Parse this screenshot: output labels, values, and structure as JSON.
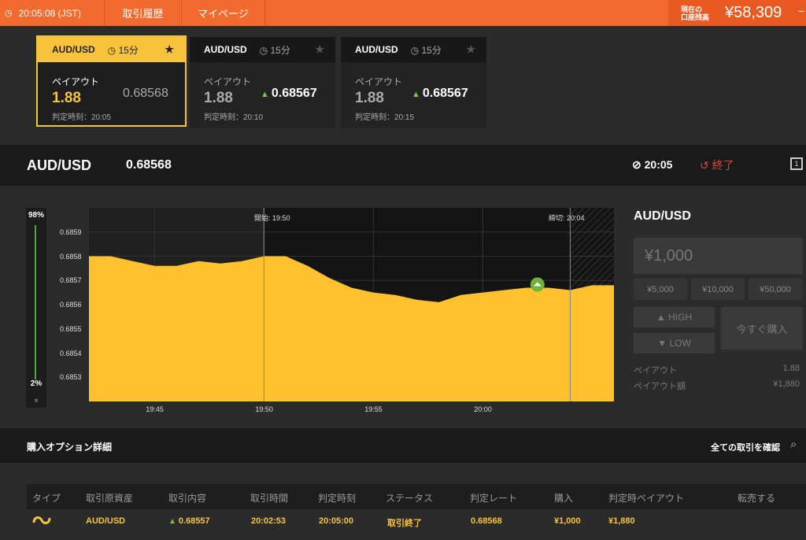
{
  "topbar": {
    "time": "20:05:08 (JST)",
    "nav": [
      "取引履歴",
      "マイページ"
    ],
    "balance_label_1": "現在の",
    "balance_label_2": "口座残高",
    "balance_value": "¥58,309"
  },
  "cards": [
    {
      "asset": "AUD/USD",
      "duration": "15分",
      "payout_label": "ペイアウト",
      "payout": "1.88",
      "rate": "0.68568",
      "judge": "判定時刻：20:05",
      "active": true
    },
    {
      "asset": "AUD/USD",
      "duration": "15分",
      "payout_label": "ペイアウト",
      "payout": "1.88",
      "rate": "0.68567",
      "judge": "判定時刻：20:10",
      "active": false
    },
    {
      "asset": "AUD/USD",
      "duration": "15分",
      "payout_label": "ペイアウト",
      "payout": "1.88",
      "rate": "0.68567",
      "judge": "判定時刻：20:15",
      "active": false
    }
  ],
  "asset_bar": {
    "name": "AUD/USD",
    "price": "0.68568",
    "deadline": "20:05",
    "status": "終了"
  },
  "sentiment": {
    "high": "98%",
    "low": "2%",
    "close": "×"
  },
  "chart_data": {
    "type": "area",
    "x": [
      "19:42",
      "19:43",
      "19:44",
      "19:45",
      "19:46",
      "19:47",
      "19:48",
      "19:49",
      "19:50",
      "19:51",
      "19:52",
      "19:53",
      "19:54",
      "19:55",
      "19:56",
      "19:57",
      "19:58",
      "19:59",
      "20:00",
      "20:01",
      "20:02",
      "20:03",
      "20:04",
      "20:05"
    ],
    "values": [
      0.6858,
      0.6858,
      0.68578,
      0.68576,
      0.68576,
      0.68578,
      0.68577,
      0.68578,
      0.6858,
      0.6858,
      0.68576,
      0.68571,
      0.68567,
      0.68565,
      0.68564,
      0.68562,
      0.68561,
      0.68564,
      0.68565,
      0.68566,
      0.68567,
      0.68567,
      0.68566,
      0.68568
    ],
    "ylim": [
      0.6852,
      0.686
    ],
    "yticks": [
      "0.6859",
      "0.6858",
      "0.6857",
      "0.6856",
      "0.6855",
      "0.6854",
      "0.6853"
    ],
    "xticks": [
      "19:45",
      "19:50",
      "19:55",
      "20:00"
    ],
    "start_label": "開始: 19:50",
    "close_label": "締切: 20:04",
    "color": "#ffc12e"
  },
  "trade": {
    "asset": "AUD/USD",
    "amount": "¥1,000",
    "presets": [
      "¥5,000",
      "¥10,000",
      "¥50,000"
    ],
    "high": "HIGH",
    "low": "LOW",
    "buy_now": "今すぐ購入",
    "payout_label": "ペイアウト",
    "payout_value": "1.88",
    "payout_amount_label": "ペイアウト額",
    "payout_amount_value": "¥1,880"
  },
  "details": {
    "title": "購入オプション詳細",
    "all_trades": "全ての取引を確認"
  },
  "table": {
    "headers": [
      "タイプ",
      "取引原資産",
      "取引内容",
      "取引時間",
      "判定時刻",
      "ステータス",
      "判定レート",
      "購入",
      "判定時ペイアウト",
      "転売する"
    ],
    "row": {
      "asset": "AUD/USD",
      "content": "0.68557",
      "time": "20:02:53",
      "judge": "20:05:00",
      "status": "取引終了",
      "rate": "0.68568",
      "purchase": "¥1,000",
      "payout": "¥1,880"
    }
  },
  "colors": {
    "accent": "#f26a2e",
    "gold": "#f8c33c",
    "up": "#7ec443",
    "down": "#e0463a"
  }
}
